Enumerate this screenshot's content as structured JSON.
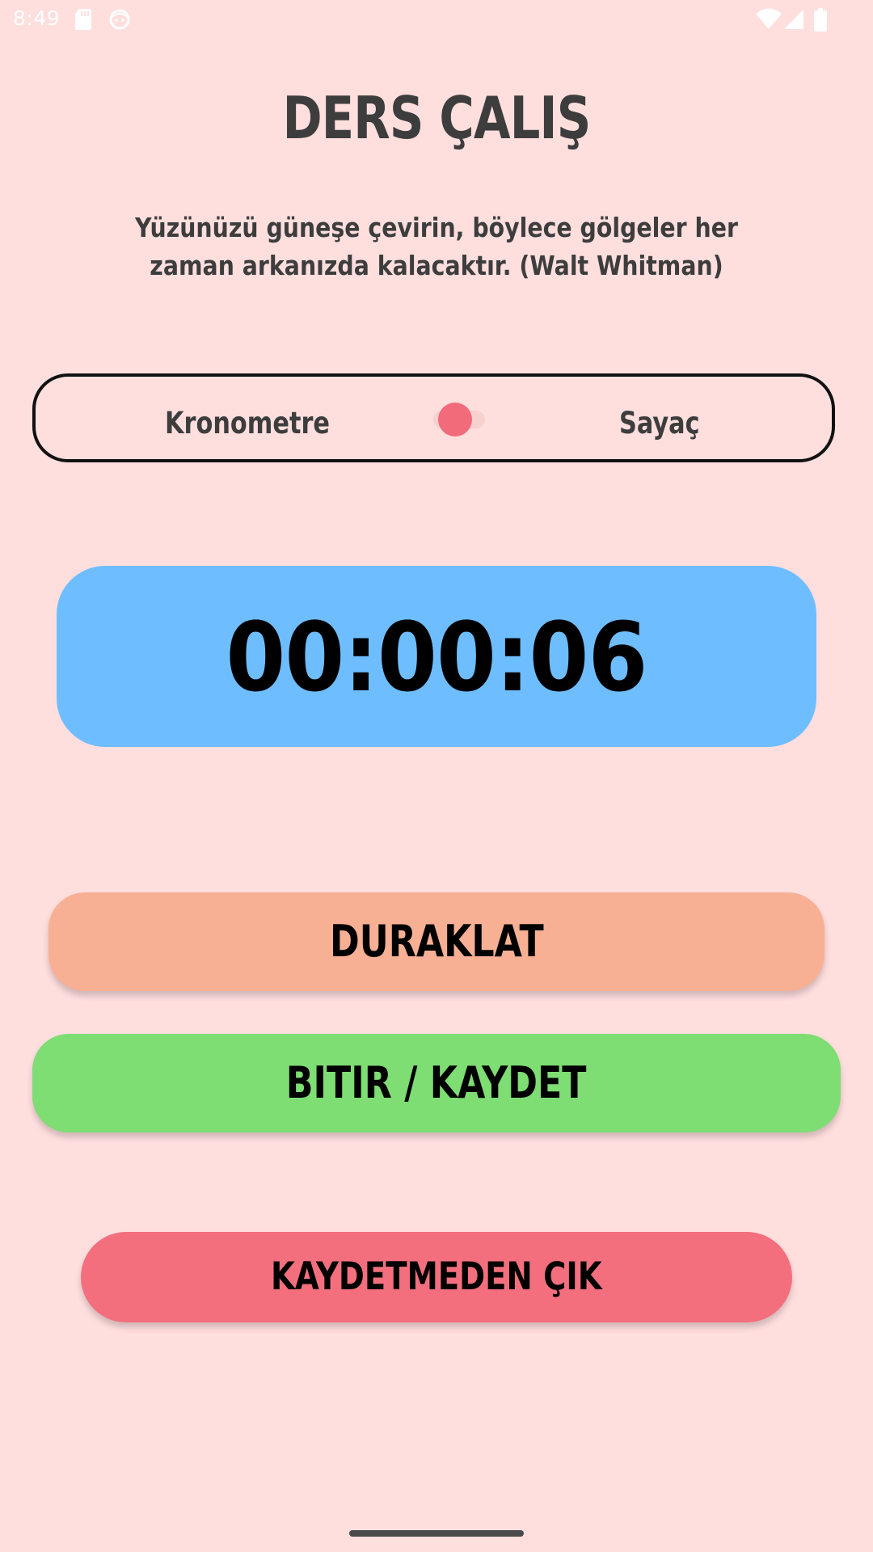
{
  "status_bar": {
    "time": "8:49",
    "left_icons": [
      "sd-card-icon",
      "face-icon"
    ],
    "right_icons": [
      "wifi-icon",
      "signal-icon",
      "battery-icon"
    ]
  },
  "header": {
    "title": "DERS ÇALIŞ",
    "quote": "Yüzünüzü güneşe çevirin, böylece gölgeler her zaman arkanızda kalacaktır. (Walt Whitman)"
  },
  "mode_selector": {
    "left_label": "Kronometre",
    "right_label": "Sayaç",
    "switch_on": false
  },
  "timer": {
    "display": "00:00:06"
  },
  "buttons": {
    "pause_label": "DURAKLAT",
    "finish_label": "BITIR / KAYDET",
    "exit_label": "KAYDETMEDEN ÇIK"
  },
  "colors": {
    "background": "#FFDEDE",
    "text": "#3D3D3D",
    "timer_bg": "#6EBEFF",
    "pause_bg": "#F7B094",
    "finish_bg": "#7EDD73",
    "exit_bg": "#F36F7E",
    "switch_thumb": "#F26B7B"
  }
}
